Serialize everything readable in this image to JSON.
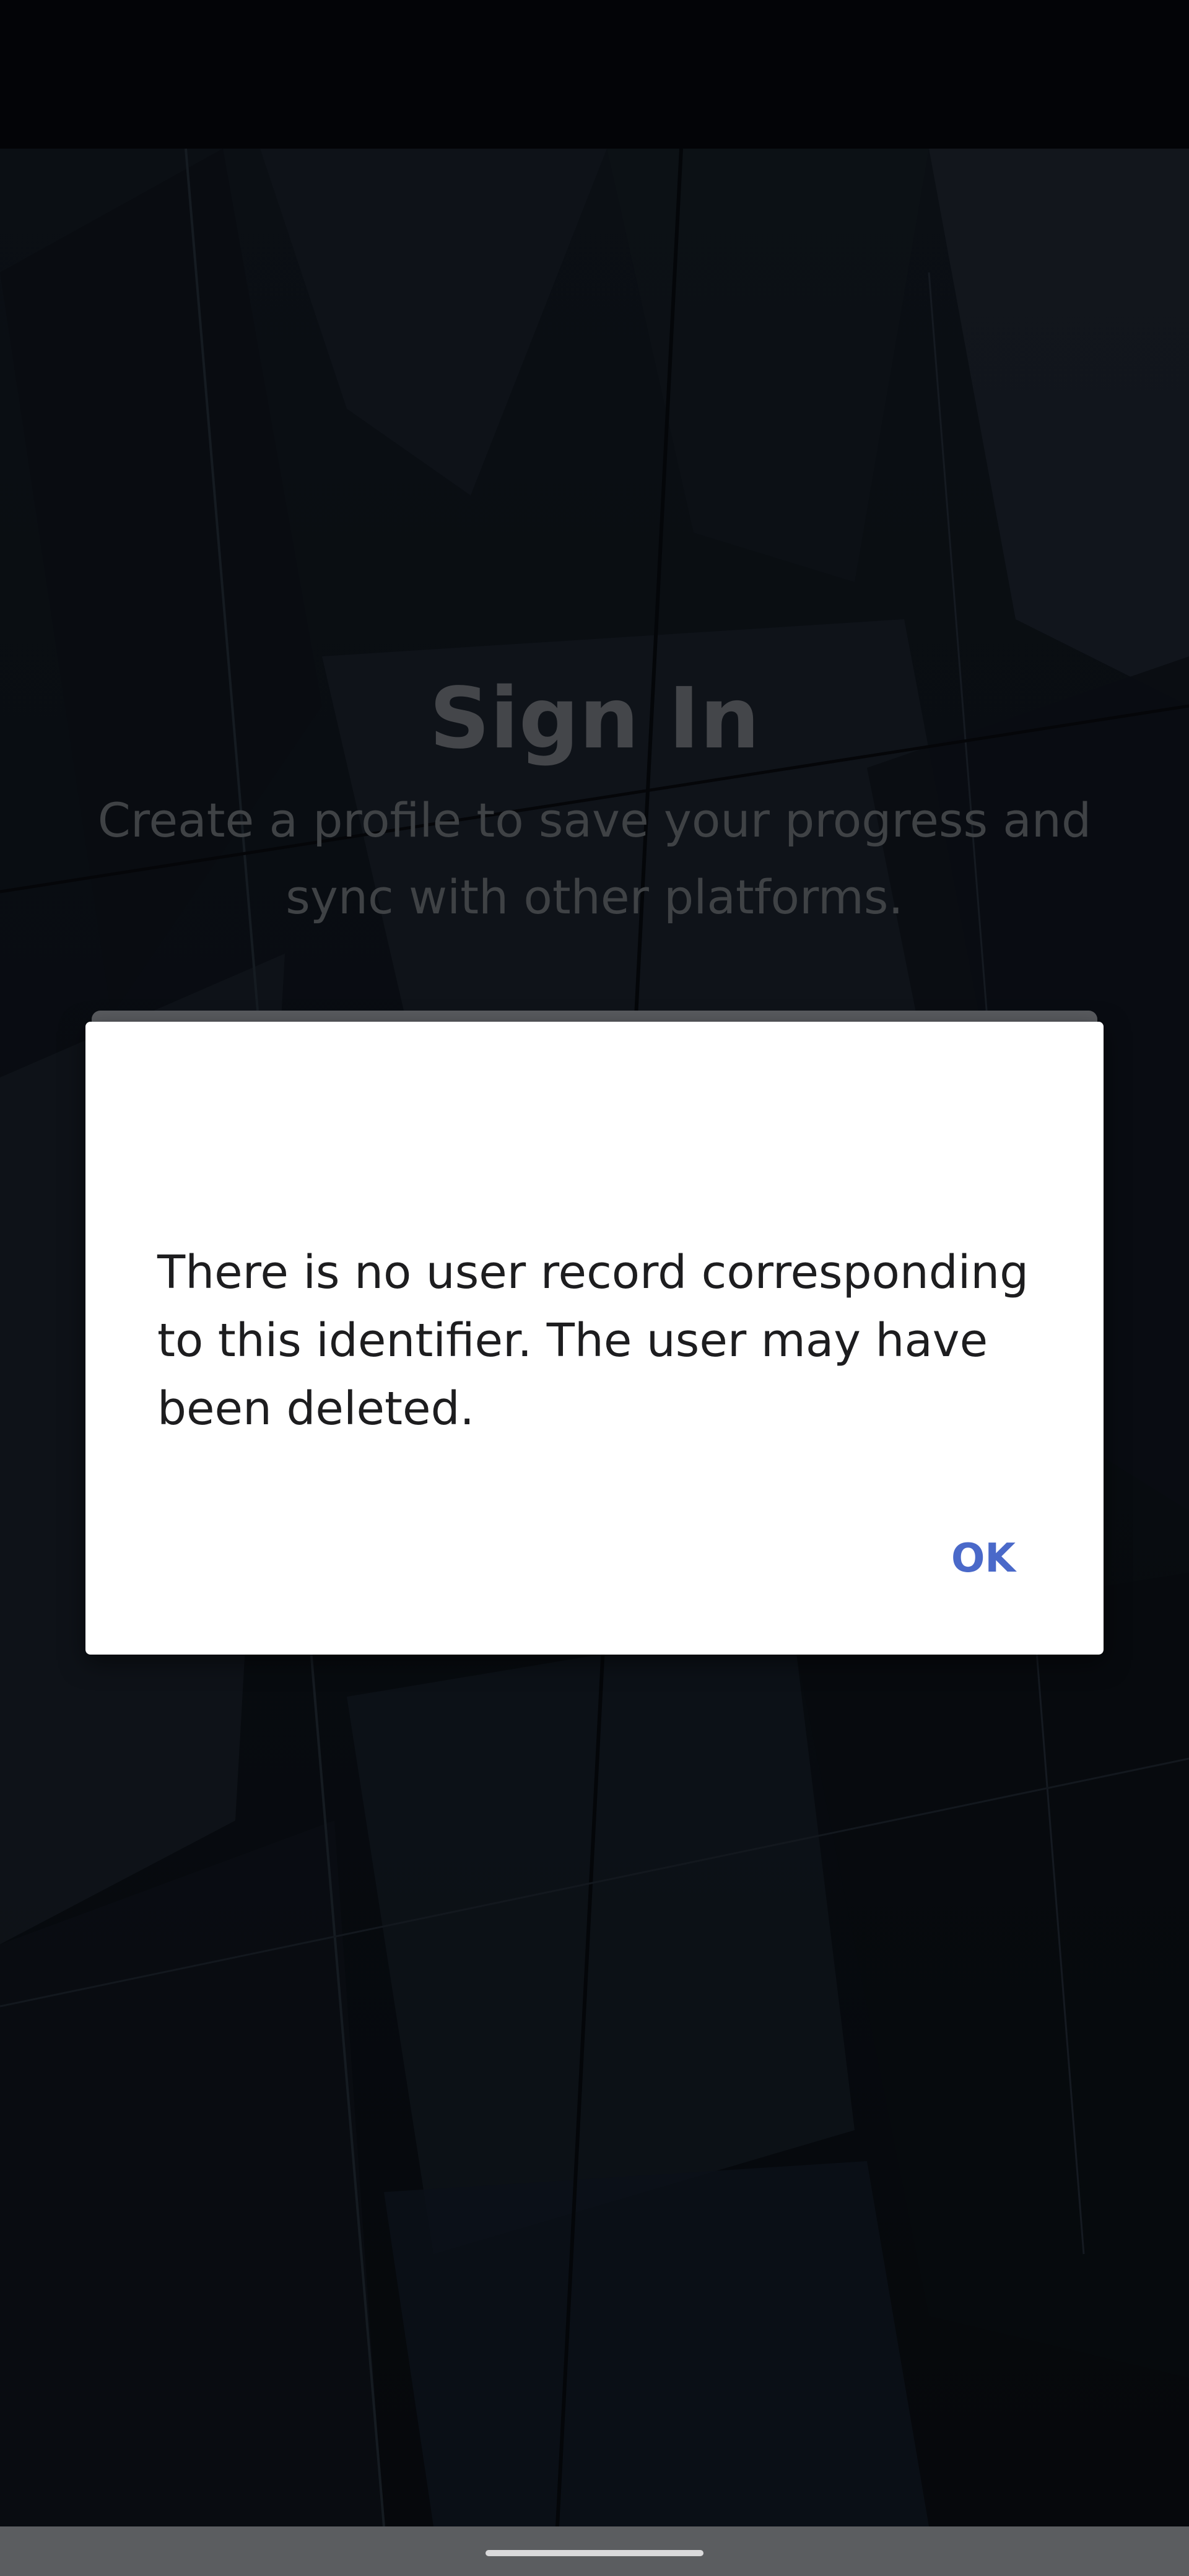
{
  "screen": {
    "title": "Sign In",
    "subtitle": "Create a profile to save your progress and sync with other platforms."
  },
  "dialog": {
    "message": "There is no user record corresponding to this identifier. The user may have been deleted.",
    "ok_label": "OK"
  },
  "colors": {
    "accent": "#4a69c9",
    "dialog_background": "#ffffff",
    "screen_background": "#0b1016"
  },
  "icons": {
    "home_handle": "gesture-handle-icon"
  }
}
